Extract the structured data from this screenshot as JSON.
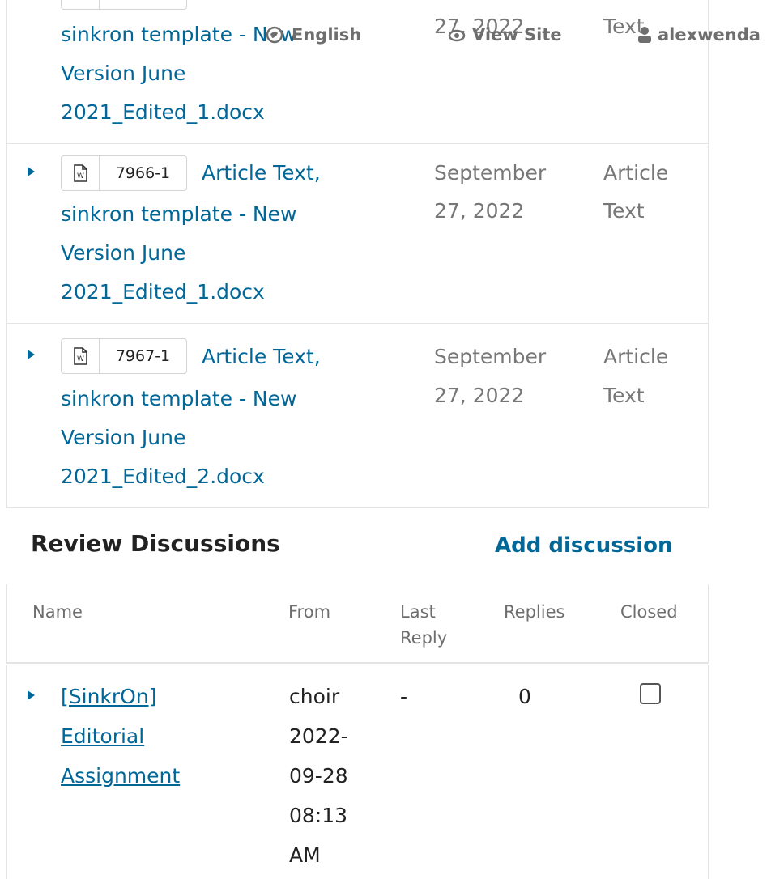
{
  "header_overlay": {
    "language": "English",
    "view_site": "View Site",
    "username": "alexwenda"
  },
  "files": [
    {
      "id": "",
      "name_lines": [
        "sinkron template - New",
        "Version June",
        "2021_Edited_1.docx"
      ],
      "date_lines": [
        "27, 2022"
      ],
      "type_lines": [
        "Text"
      ]
    },
    {
      "id": "7966-1",
      "name_lines": [
        "Article Text,",
        "sinkron template - New",
        "Version June",
        "2021_Edited_1.docx"
      ],
      "date_lines": [
        "September",
        "27, 2022"
      ],
      "type_lines": [
        "Article",
        "Text"
      ]
    },
    {
      "id": "7967-1",
      "name_lines": [
        "Article Text,",
        "sinkron template - New",
        "Version June",
        "2021_Edited_2.docx"
      ],
      "date_lines": [
        "September",
        "27, 2022"
      ],
      "type_lines": [
        "Article",
        "Text"
      ]
    }
  ],
  "review_discussions": {
    "title": "Review Discussions",
    "add_label": "Add discussion",
    "columns": {
      "name": "Name",
      "from": "From",
      "last_reply": [
        "Last",
        "Reply"
      ],
      "replies": "Replies",
      "closed": "Closed"
    },
    "rows": [
      {
        "name_lines": [
          "[SinkrOn]",
          "Editorial",
          "Assignment"
        ],
        "from_lines": [
          "choir",
          "2022-",
          "09-28",
          "08:13",
          "AM"
        ],
        "last_reply": "-",
        "replies": "0",
        "closed": false
      }
    ]
  },
  "colors": {
    "link": "#006798",
    "muted": "#777777",
    "border": "#e4e4e4"
  }
}
